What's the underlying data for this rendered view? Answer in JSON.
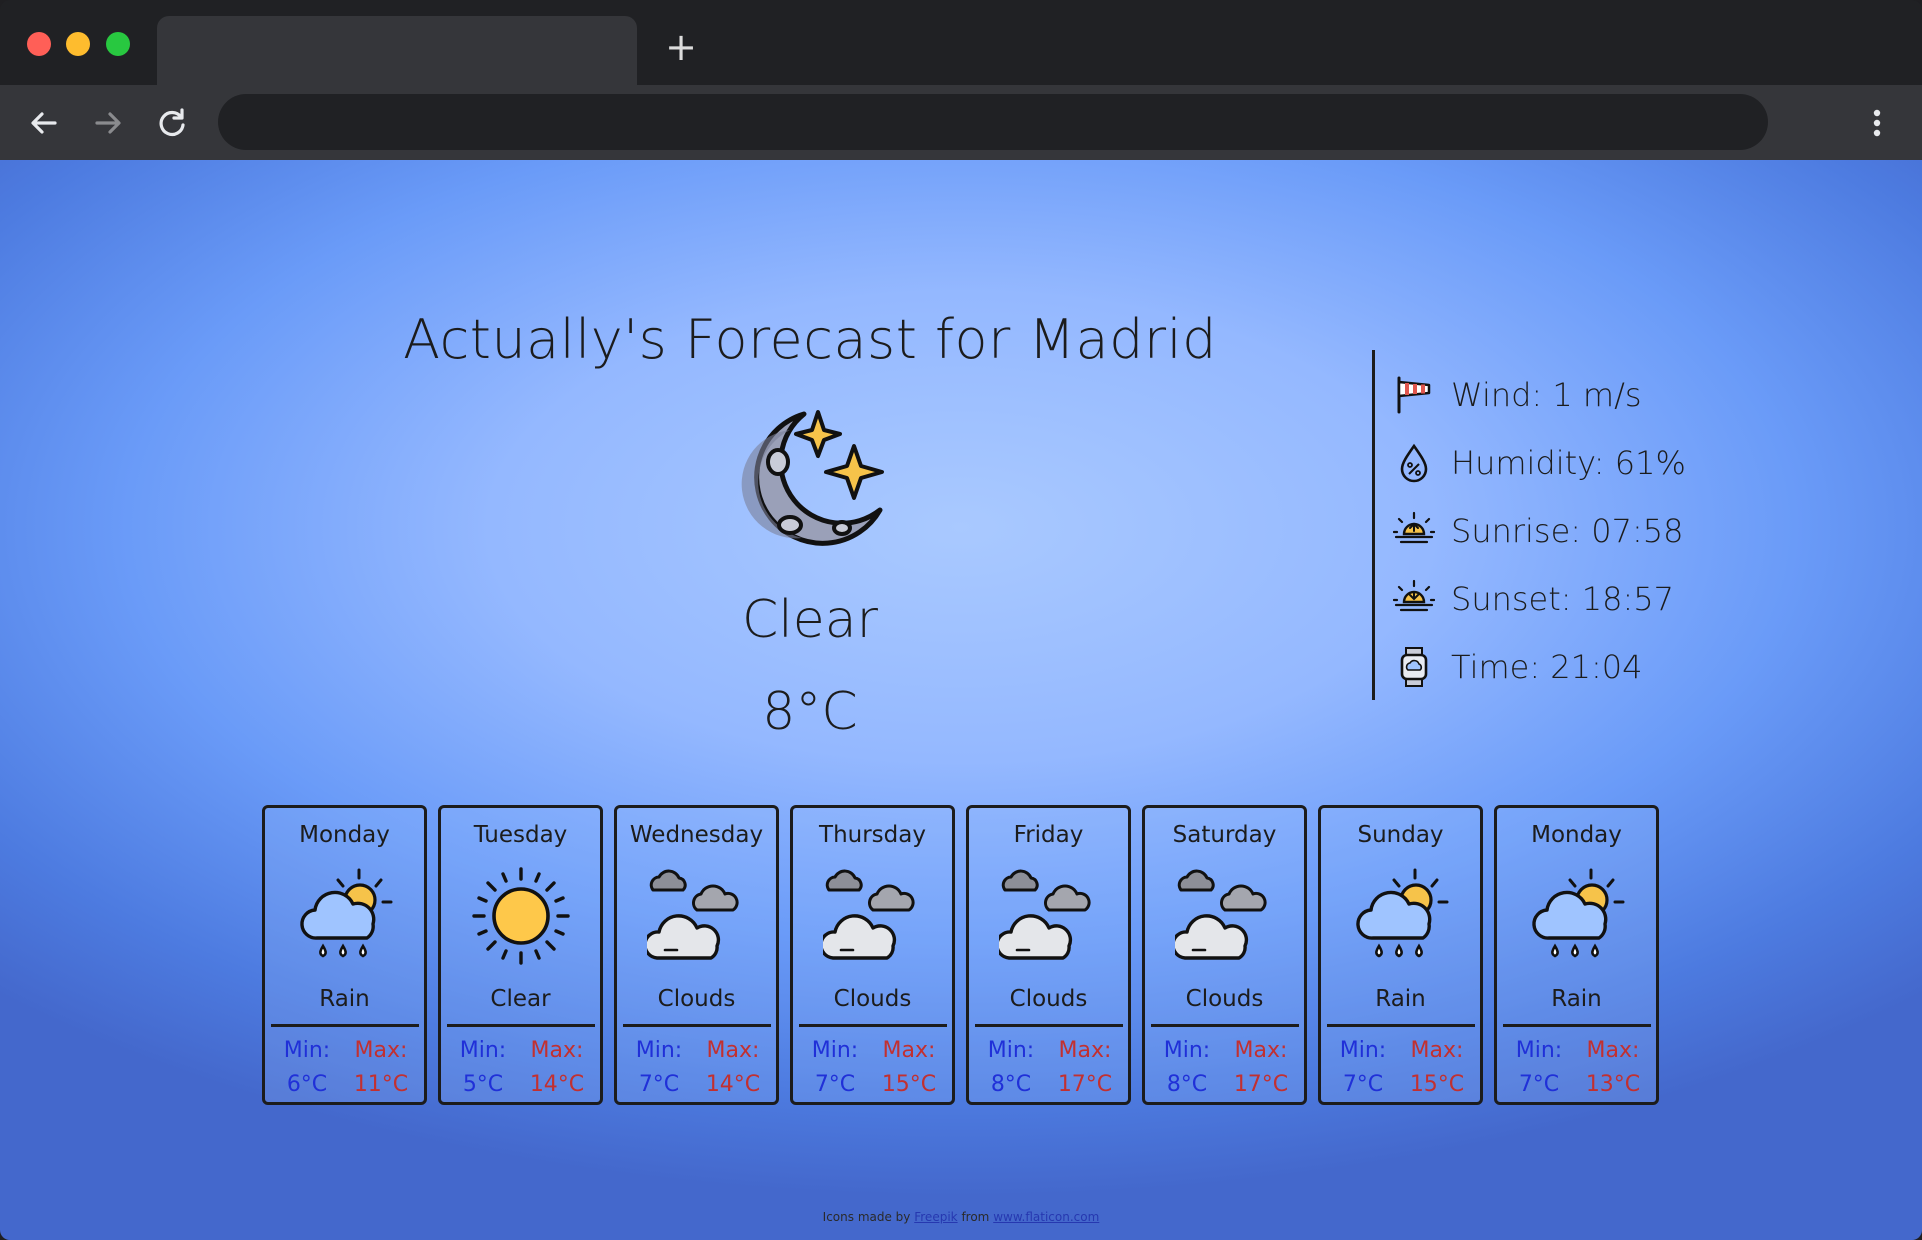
{
  "browser": {
    "new_tab_glyph": "+",
    "icons": [
      "back-arrow-icon",
      "forward-arrow-icon",
      "reload-icon",
      "more-vert-icon"
    ]
  },
  "weather": {
    "title": "Actually's Forecast for Madrid",
    "current": {
      "icon": "moon-stars-icon",
      "description": "Clear",
      "temperature": "8°C"
    },
    "details": [
      {
        "icon": "windsock-icon",
        "text": "Wind: 1 m/s"
      },
      {
        "icon": "humidity-drop-icon",
        "text": "Humidity: 61%"
      },
      {
        "icon": "sunrise-icon",
        "text": "Sunrise: 07:58"
      },
      {
        "icon": "sunset-icon",
        "text": "Sunset: 18:57"
      },
      {
        "icon": "smartwatch-icon",
        "text": "Time: 21:04"
      }
    ],
    "min_label": "Min:",
    "max_label": "Max:",
    "forecast": [
      {
        "day": "Monday",
        "icon": "rain-icon",
        "description": "Rain",
        "min": "6°C",
        "max": "11°C"
      },
      {
        "day": "Tuesday",
        "icon": "sun-icon",
        "description": "Clear",
        "min": "5°C",
        "max": "14°C"
      },
      {
        "day": "Wednesday",
        "icon": "clouds-icon",
        "description": "Clouds",
        "min": "7°C",
        "max": "14°C"
      },
      {
        "day": "Thursday",
        "icon": "clouds-icon",
        "description": "Clouds",
        "min": "7°C",
        "max": "15°C"
      },
      {
        "day": "Friday",
        "icon": "clouds-icon",
        "description": "Clouds",
        "min": "8°C",
        "max": "17°C"
      },
      {
        "day": "Saturday",
        "icon": "clouds-icon",
        "description": "Clouds",
        "min": "8°C",
        "max": "17°C"
      },
      {
        "day": "Sunday",
        "icon": "rain-icon",
        "description": "Rain",
        "min": "7°C",
        "max": "15°C"
      },
      {
        "day": "Monday",
        "icon": "rain-icon",
        "description": "Rain",
        "min": "7°C",
        "max": "13°C"
      }
    ]
  },
  "credit": {
    "prefix": "Icons made by",
    "author": "Freepik",
    "middle": "from",
    "site": "www.flaticon.com"
  },
  "colors": {
    "min_text": "#2030d8",
    "max_text": "#c23030",
    "background_center": "#a9c9ff",
    "background_edge": "#4468cc"
  }
}
